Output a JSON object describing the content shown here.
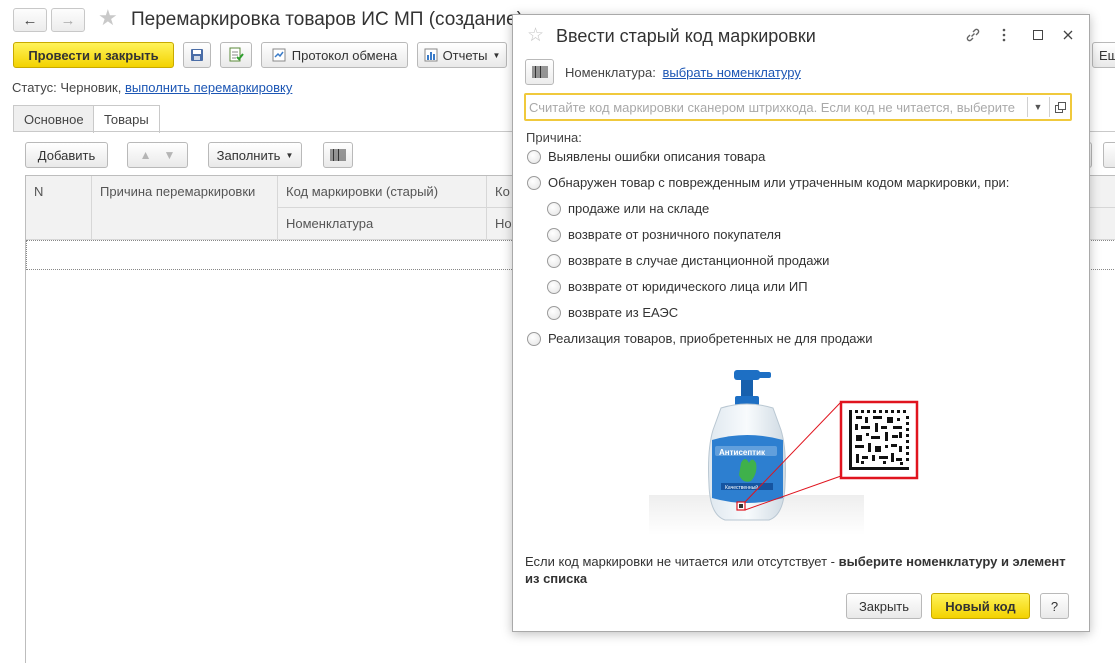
{
  "document": {
    "title": "Перемаркировка товаров ИС МП (создание)",
    "toolbar": {
      "post_close_label": "Провести и закрыть",
      "exchange_log_label": "Протокол обмена",
      "reports_label": "Отчеты",
      "more_label": "Еще"
    },
    "status": {
      "label": "Статус:",
      "value": "Черновик,",
      "action_link": "выполнить перемаркировку"
    },
    "tabs": [
      {
        "label": "Основное"
      },
      {
        "label": "Товары"
      }
    ],
    "table_toolbar": {
      "add_label": "Добавить",
      "fill_label": "Заполнить"
    },
    "columns": {
      "n": "N",
      "reason": "Причина перемаркировки",
      "old_code": "Код маркировки (старый)",
      "nomenclature": "Номенклатура",
      "col5_top": "Ко",
      "col5_bottom": "Но"
    }
  },
  "dialog": {
    "title": "Ввести старый код маркировки",
    "nomenclature_label": "Номенклатура:",
    "nomenclature_link": "выбрать номенклатуру",
    "scan_placeholder": "Считайте код маркировки сканером штрихкода. Если код не читается, выберите",
    "reason_label": "Причина:",
    "reasons": [
      "Выявлены ошибки описания товара",
      "Обнаружен товар с поврежденным или утраченным кодом маркировки, при:",
      "продаже или на складе",
      "возврате от розничного покупателя",
      "возврате в случае дистанционной продажи",
      "возврате от юридического лица или ИП",
      "возврате из ЕАЭС",
      "Реализация товаров, приобретенных не для продажи"
    ],
    "illustration": {
      "product_label": "Антисептик",
      "product_sublabel": "Качественный"
    },
    "hint_plain": "Если код маркировки не читается или отсутствует -",
    "hint_bold": "выберите номенклатуру и элемент из списка",
    "buttons": {
      "close_label": "Закрыть",
      "new_code_label": "Новый код",
      "help_label": "?"
    }
  },
  "colors": {
    "accent_yellow": "#f7dc1f",
    "link_blue": "#1c56b4",
    "focus_border": "#f0c93c",
    "qr_frame_red": "#e0141e"
  }
}
